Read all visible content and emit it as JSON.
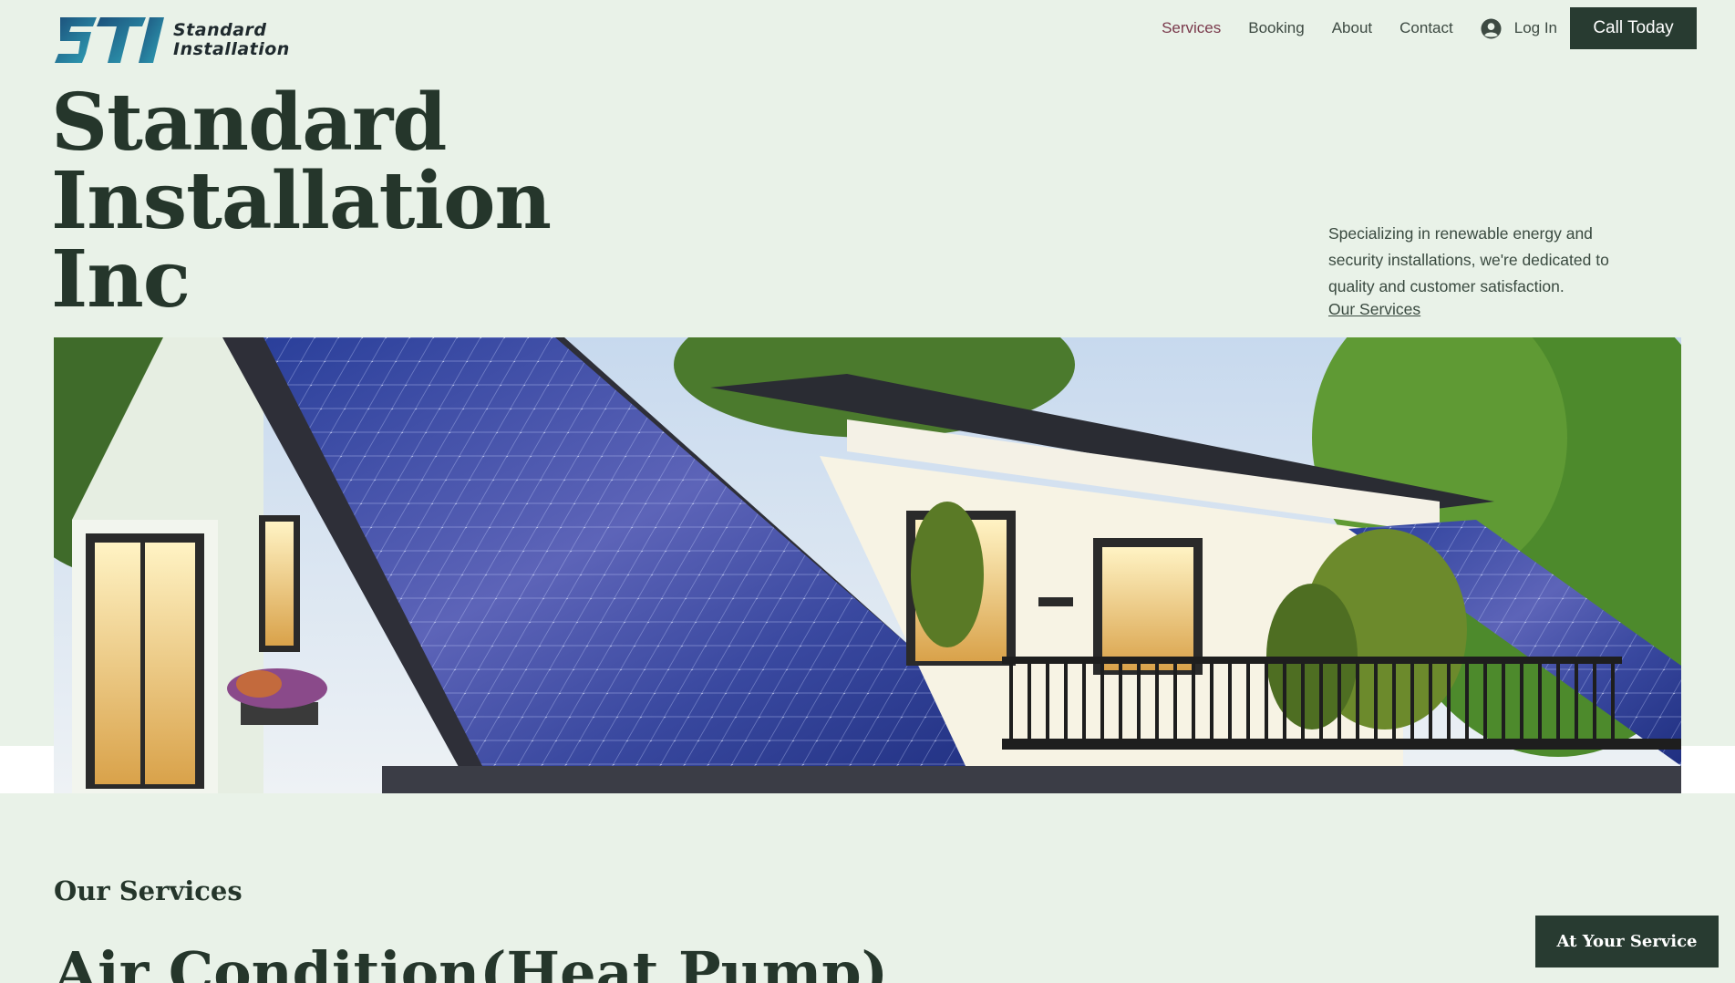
{
  "brand": {
    "logo_line1": "Standard",
    "logo_line2": "Installation",
    "colors": {
      "primary": "#283b31",
      "background": "#e9f2e8",
      "nav_active": "#7a3a4c",
      "logo_blue": "#2b6fa3"
    }
  },
  "nav": {
    "items": [
      {
        "label": "Services",
        "active": true
      },
      {
        "label": "Booking"
      },
      {
        "label": "About"
      },
      {
        "label": "Contact"
      }
    ],
    "login_label": "Log In",
    "login_icon": "user-avatar-icon",
    "cta_label": "Call Today"
  },
  "hero": {
    "title_line1": "Standard",
    "title_line2": "Installation",
    "title_line3": "Inc",
    "description": "Specializing in renewable energy and security installations, we're dedicated to quality and customer satisfaction.",
    "link_label": "Our Services"
  },
  "sections": {
    "label": "Our Services",
    "heading": "Air Condition(Heat Pump)"
  },
  "floating_button_label": "At Your Service"
}
